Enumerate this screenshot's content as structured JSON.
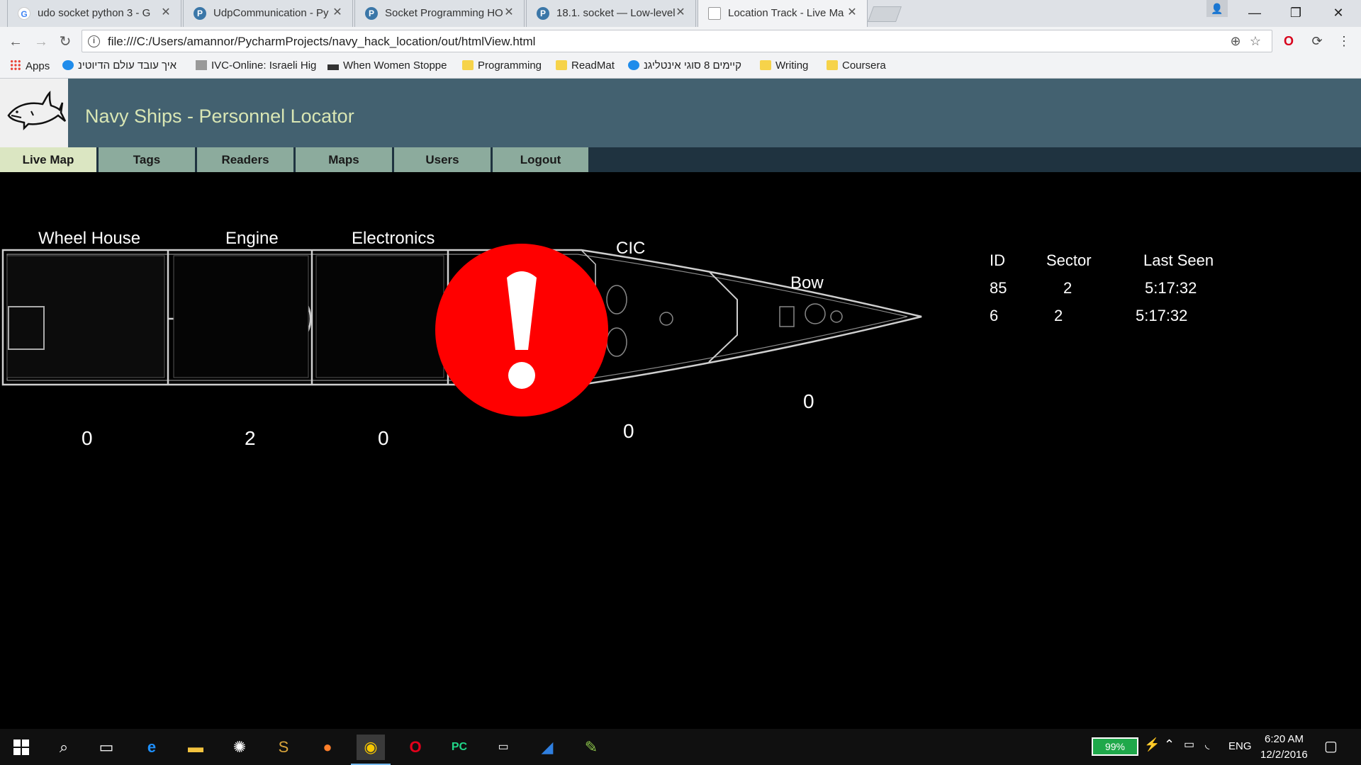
{
  "browser": {
    "tabs": [
      {
        "title": "udo socket python 3 - G",
        "icon": "google-icon"
      },
      {
        "title": "UdpCommunication - Py",
        "icon": "python-icon"
      },
      {
        "title": "Socket Programming HO",
        "icon": "python-icon"
      },
      {
        "title": "18.1. socket — Low-level",
        "icon": "python-icon"
      },
      {
        "title": "Location Track - Live Ma",
        "icon": "page-icon"
      }
    ],
    "url": "file:///C:/Users/amannor/PycharmProjects/navy_hack_location/out/htmlView.html",
    "bookmarks": [
      {
        "label": "Apps",
        "icon": "apps-icon"
      },
      {
        "label": "איך עובד עולם הדיוטינ",
        "icon": "site-icon"
      },
      {
        "label": "IVC-Online: Israeli Hig",
        "icon": "site-icon"
      },
      {
        "label": "When Women Stoppe",
        "icon": "site-icon"
      },
      {
        "label": "Programming",
        "icon": "folder-icon"
      },
      {
        "label": "ReadMat",
        "icon": "folder-icon"
      },
      {
        "label": "קיימים 8 סוגי אינטליגנ",
        "icon": "site-icon"
      },
      {
        "label": "Writing",
        "icon": "folder-icon"
      },
      {
        "label": "Coursera",
        "icon": "folder-icon"
      }
    ]
  },
  "app": {
    "title": "Navy Ships - Personnel Locator",
    "nav": [
      {
        "label": "Live Map",
        "active": true
      },
      {
        "label": "Tags",
        "active": false
      },
      {
        "label": "Readers",
        "active": false
      },
      {
        "label": "Maps",
        "active": false
      },
      {
        "label": "Users",
        "active": false
      },
      {
        "label": "Logout",
        "active": false
      }
    ],
    "sectors": [
      {
        "name": "Wheel House",
        "count": "0"
      },
      {
        "name": "Engine",
        "count": "2"
      },
      {
        "name": "Electronics",
        "count": "0"
      },
      {
        "name": "CIC",
        "count": "0"
      },
      {
        "name": "Bow",
        "count": "0"
      }
    ],
    "alert": {
      "symbol": "!",
      "color": "#ff0000"
    },
    "table": {
      "headers": [
        "ID",
        "Sector",
        "Last Seen"
      ],
      "rows": [
        [
          "85",
          "2",
          "5:17:32"
        ],
        [
          "6",
          "2",
          "5:17:32"
        ]
      ]
    }
  },
  "taskbar": {
    "battery": "99%",
    "language": "ENG",
    "time": "6:20 AM",
    "date": "12/2/2016"
  },
  "colors": {
    "header_bg": "#436170",
    "nav_bg": "#1f3340",
    "nav_tab": "#8cab9d",
    "nav_tab_active": "#dbe6c2",
    "title_text": "#d9e6b4",
    "alert_red": "#ff0000"
  }
}
